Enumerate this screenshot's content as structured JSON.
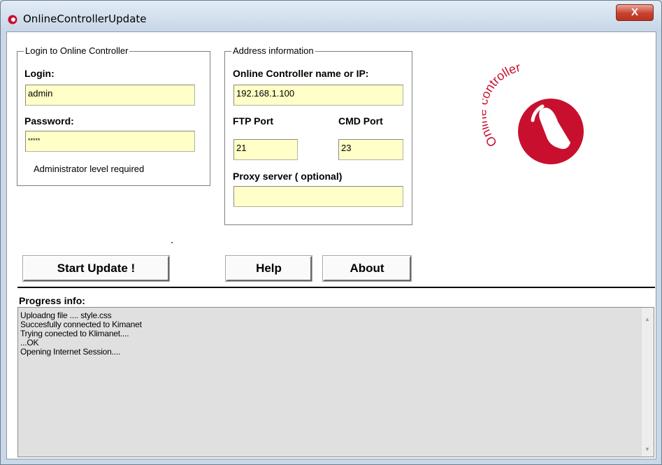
{
  "window": {
    "title": "OnlineControllerUpdate",
    "close_label": "X"
  },
  "login": {
    "group_title": "Login to Online Controller",
    "login_label": "Login:",
    "login_value": "admin",
    "password_label": "Password:",
    "password_value": "*****",
    "note": "Administrator level required"
  },
  "address": {
    "group_title": "Address information",
    "host_label": "Online Controller name or IP:",
    "host_value": "192.168.1.100",
    "ftp_label": "FTP Port",
    "ftp_value": "21",
    "cmd_label": "CMD Port",
    "cmd_value": "23",
    "proxy_label": "Proxy server ( optional)",
    "proxy_value": ""
  },
  "logo": {
    "text": "Online controller",
    "color": "#c8102e"
  },
  "buttons": {
    "start": "Start Update !",
    "help": "Help",
    "about": "About"
  },
  "progress": {
    "label": "Progress info:",
    "lines": [
      "Uploadng file .... style.css",
      "Succesfully connected to Kimanet",
      "Trying conected to Klimanet....",
      "...OK",
      "Opening Internet Session...."
    ]
  },
  "colors": {
    "field_bg": "#ffffc7",
    "close_button": "#c8412f",
    "log_bg": "#e0e0e0"
  },
  "icons": {
    "app": "online-controller-logo-icon",
    "scroll_up": "triangle-up",
    "scroll_down": "triangle-down"
  }
}
